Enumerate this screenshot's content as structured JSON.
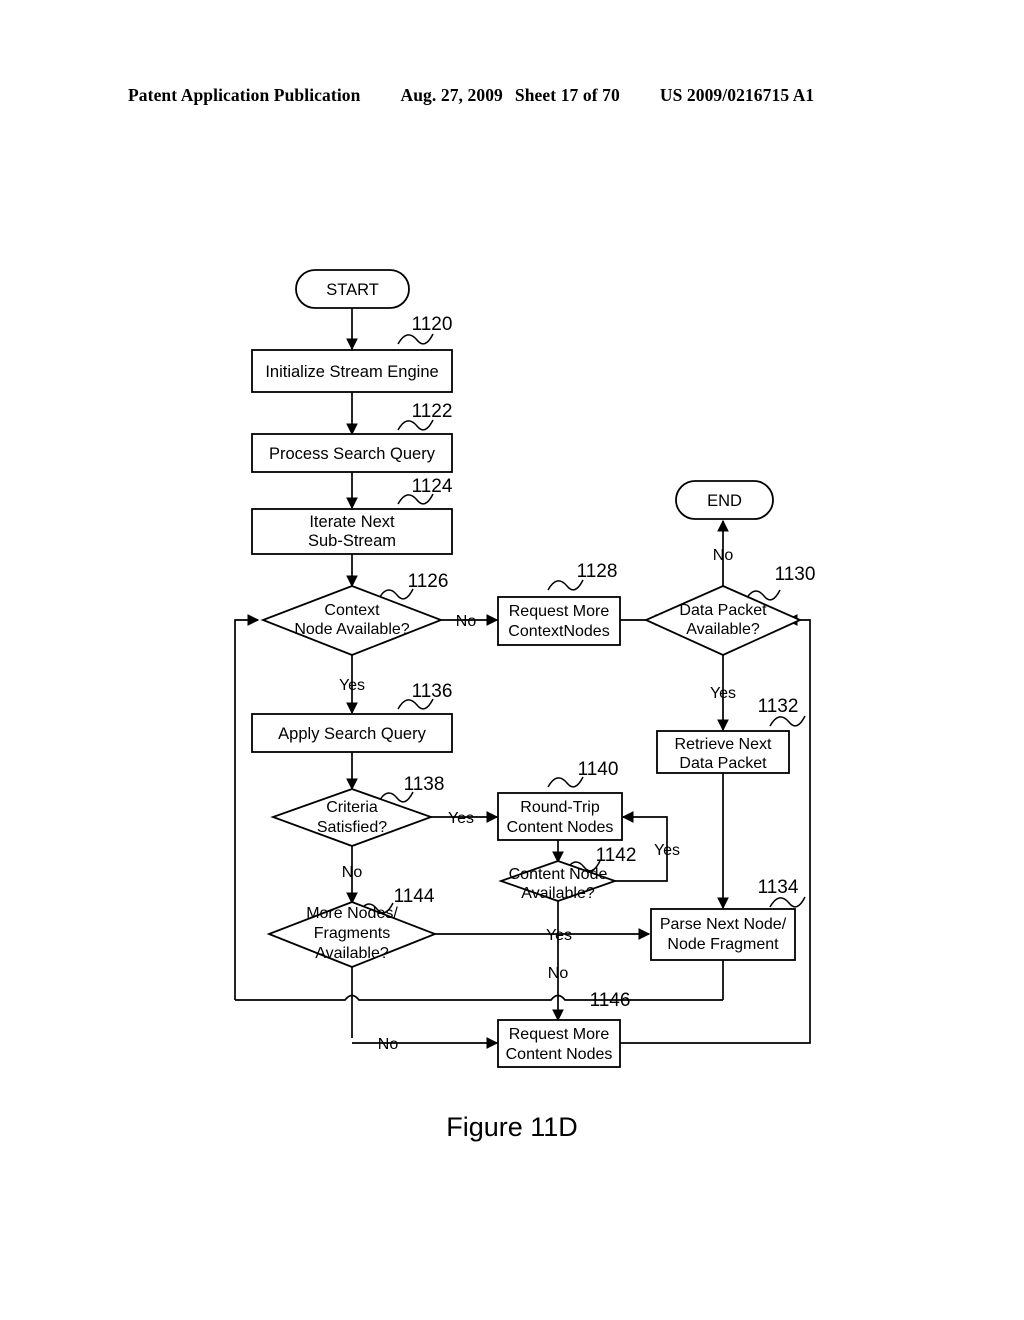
{
  "header": {
    "publication": "Patent Application Publication",
    "date": "Aug. 27, 2009",
    "sheet": "Sheet 17 of 70",
    "patent_number": "US 2009/0216715 A1"
  },
  "figure": {
    "caption": "Figure 11D"
  },
  "colors": {
    "ink": "#000000",
    "paper": "#ffffff"
  },
  "flowchart": {
    "terminals": [
      {
        "id": "start",
        "label": "START"
      },
      {
        "id": "end",
        "label": "END"
      }
    ],
    "processes": [
      {
        "id": "p1120",
        "ref": "1120",
        "line1": "Initialize Stream Engine",
        "line2": ""
      },
      {
        "id": "p1122",
        "ref": "1122",
        "line1": "Process Search Query",
        "line2": ""
      },
      {
        "id": "p1124",
        "ref": "1124",
        "line1": "Iterate Next",
        "line2": "Sub-Stream"
      },
      {
        "id": "p1128",
        "ref": "1128",
        "line1": "Request More",
        "line2": "ContextNodes"
      },
      {
        "id": "p1132",
        "ref": "1132",
        "line1": "Retrieve Next",
        "line2": "Data Packet"
      },
      {
        "id": "p1134",
        "ref": "1134",
        "line1": "Parse Next Node/",
        "line2": "Node Fragment"
      },
      {
        "id": "p1136",
        "ref": "1136",
        "line1": "Apply Search Query",
        "line2": ""
      },
      {
        "id": "p1140",
        "ref": "1140",
        "line1": "Round-Trip",
        "line2": "Content Nodes"
      },
      {
        "id": "p1146",
        "ref": "1146",
        "line1": "Request More",
        "line2": "Content Nodes"
      }
    ],
    "decisions": [
      {
        "id": "d1126",
        "ref": "1126",
        "line1": "Context",
        "line2": "Node Available?",
        "line3": ""
      },
      {
        "id": "d1130",
        "ref": "1130",
        "line1": "Data Packet",
        "line2": "Available?",
        "line3": ""
      },
      {
        "id": "d1138",
        "ref": "1138",
        "line1": "Criteria",
        "line2": "Satisfied?",
        "line3": ""
      },
      {
        "id": "d1142",
        "ref": "1142",
        "line1": "Content Node",
        "line2": "Available?",
        "line3": ""
      },
      {
        "id": "d1144",
        "ref": "1144",
        "line1": "More Nodes/",
        "line2": "Fragments",
        "line3": "Available?"
      }
    ],
    "edge_labels": {
      "d1126_no": "No",
      "d1126_yes": "Yes",
      "d1130_no": "No",
      "d1130_yes": "Yes",
      "d1138_yes": "Yes",
      "d1138_no": "No",
      "d1142_yes_loop": "Yes",
      "d1142_yes": "Yes",
      "d1142_no": "No",
      "d1144_no": "No"
    }
  }
}
